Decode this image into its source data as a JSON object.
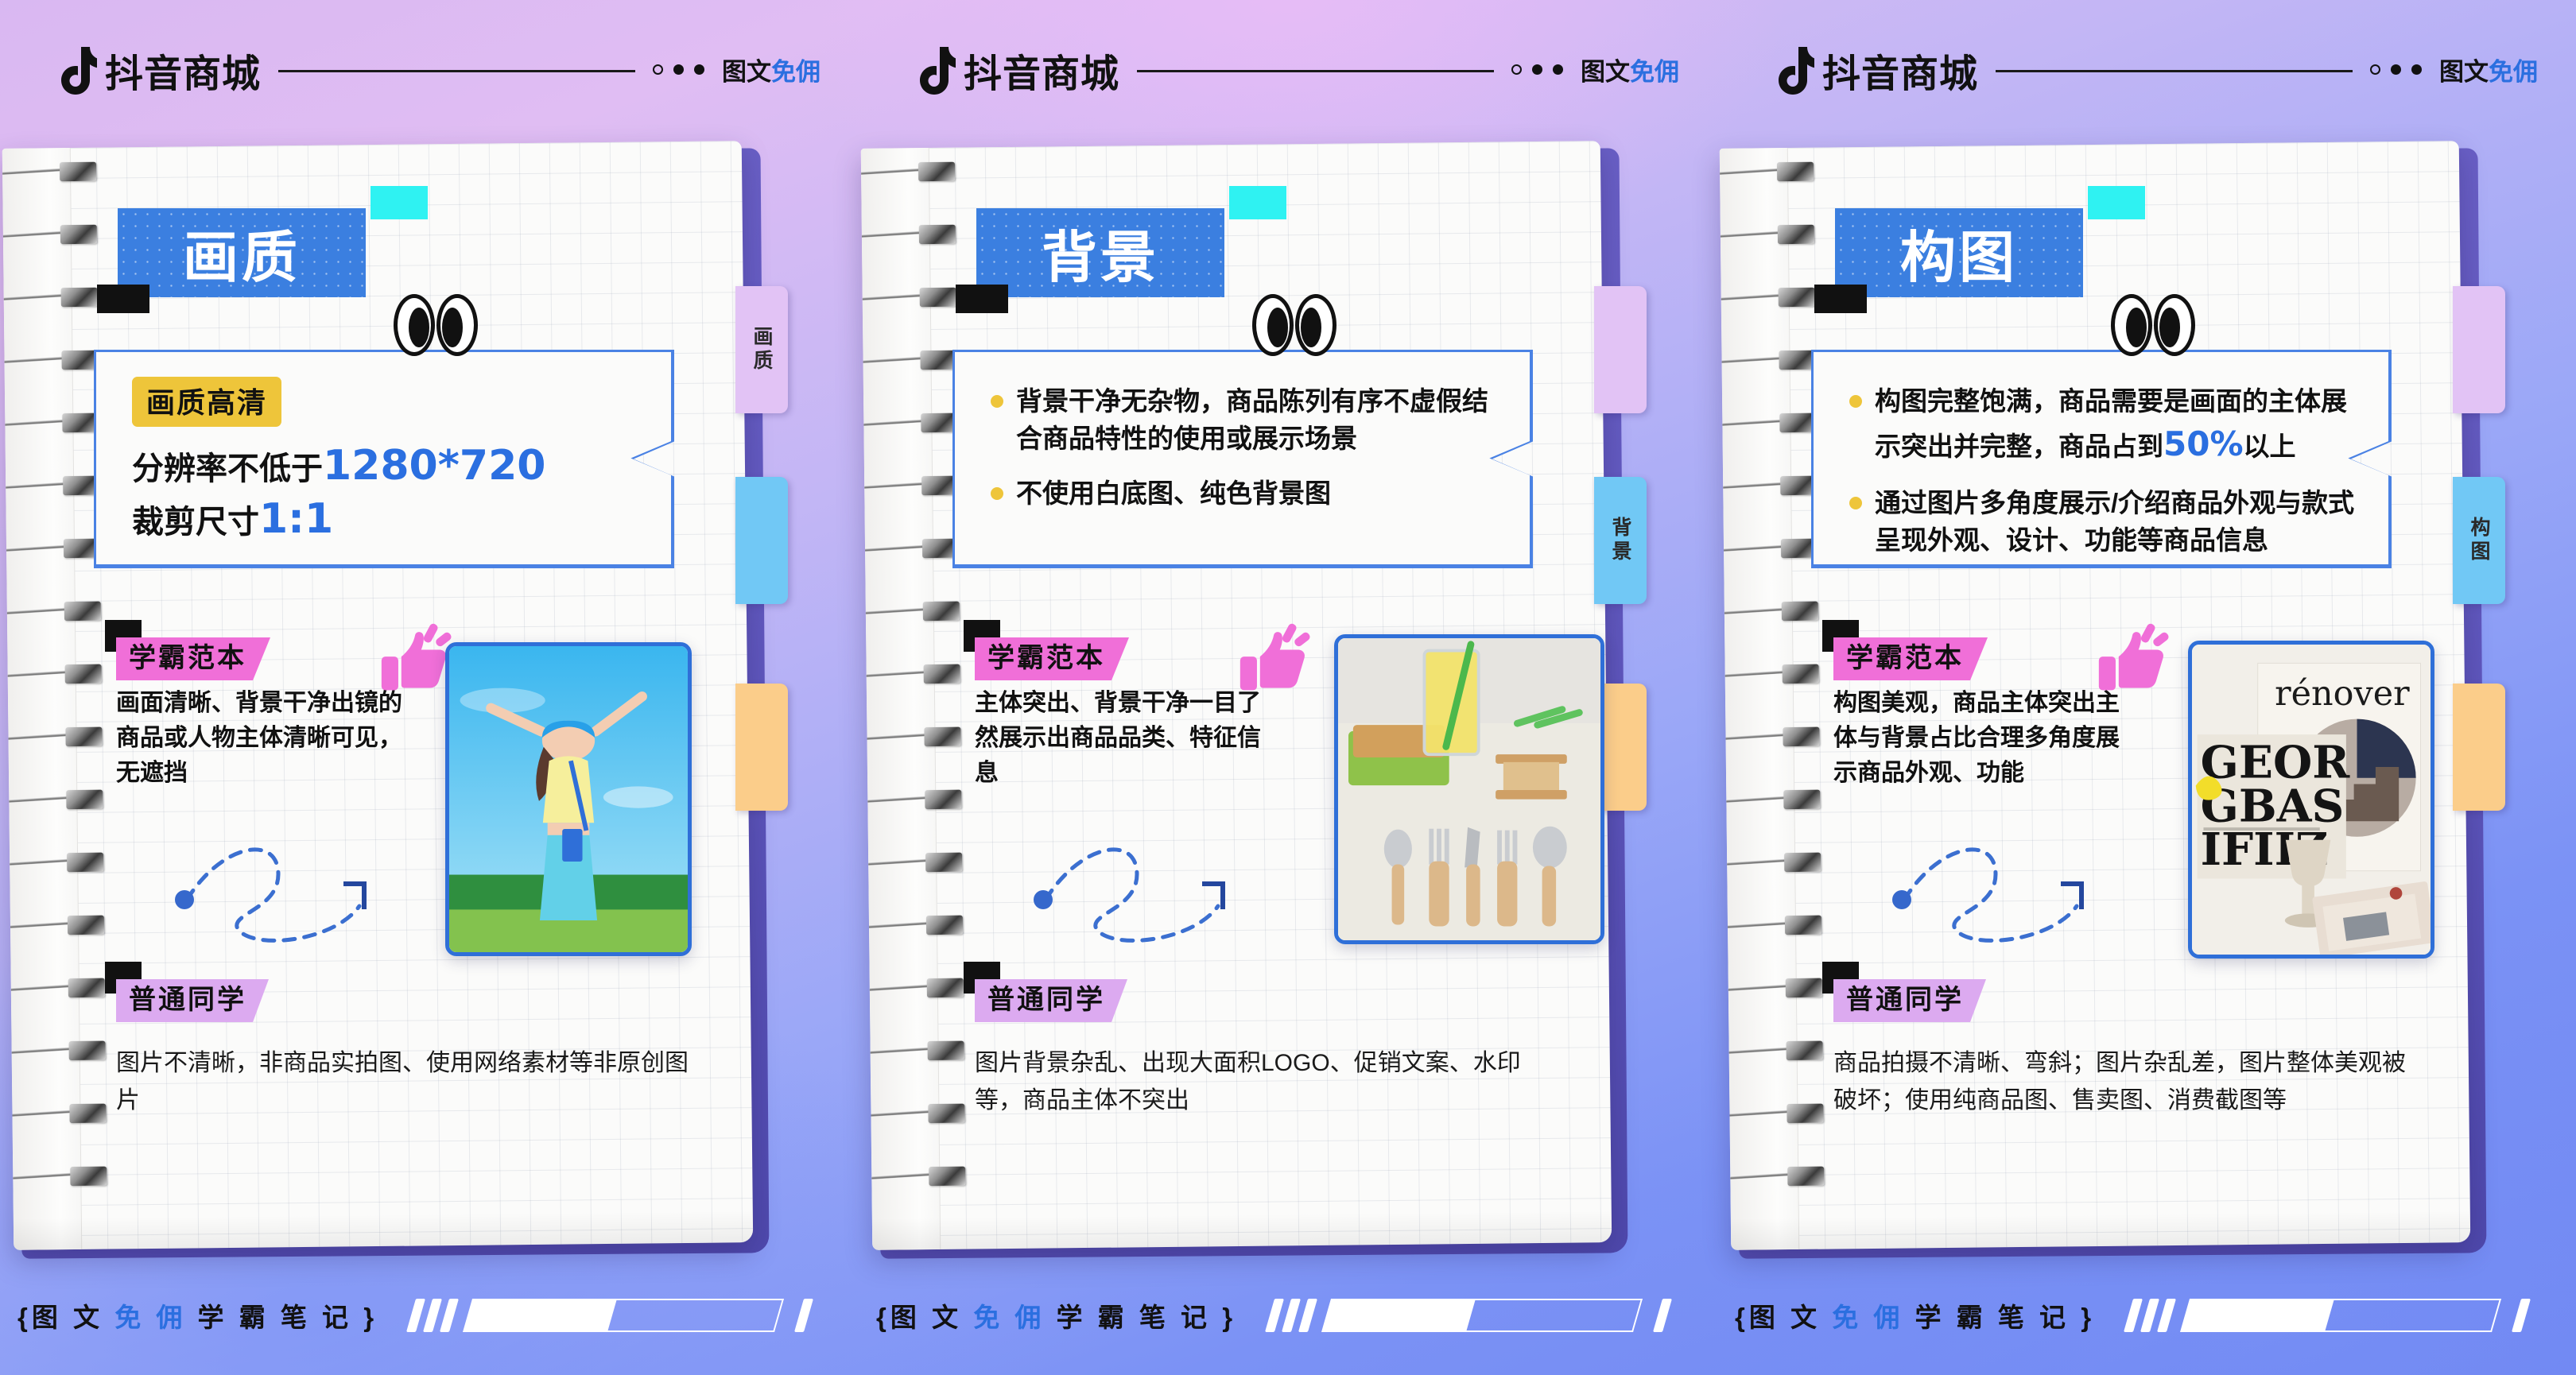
{
  "brand": {
    "name": "抖音商城",
    "logo_icon": "tiktok-note-icon",
    "tagline_plain": "图文",
    "tagline_highlight": "免佣",
    "accent_blue": "#2b6fe0",
    "title_chip_blue": "#3b7fe0",
    "cyan_chip": "#2ff2f2",
    "yellow_badge": "#eec53a",
    "pink_chip": "#f06fd8",
    "violet_chip": "#dcaaf0"
  },
  "footer": {
    "open_brace": "{",
    "text_a": "图 文 ",
    "text_hl": "免 佣",
    "text_b": "  学 霸 笔 记 ",
    "close_brace": "}"
  },
  "side_tabs": {
    "labels": [
      "画质",
      "背景",
      "构图"
    ],
    "colors": [
      "#e2c3f5",
      "#71c8f5",
      "#fbcd8a"
    ]
  },
  "panels": [
    {
      "title": "画质",
      "active_tab_index": 0,
      "callout": {
        "style": "badge",
        "badge": "画质高清",
        "lines": [
          {
            "pre": "分辨率不低于",
            "num": "1280*720"
          },
          {
            "pre": "裁剪尺寸",
            "num": "1:1"
          }
        ]
      },
      "good": {
        "label": "学霸范本",
        "text": "画面清晰、背景干净出镜的商品或人物主体清晰可见，无遮挡",
        "thumb_icon": "thumbs-up-icon",
        "photo_alt": "户外张开双臂的运动女孩照片"
      },
      "bad": {
        "label": "普通同学",
        "text": "图片不清晰，非商品实拍图、使用网络素材等非原创图片"
      }
    },
    {
      "title": "背景",
      "active_tab_index": 1,
      "callout": {
        "style": "bullets",
        "bullets": [
          {
            "text": "背景干净无杂物，商品陈列有序不虚假结合商品特性的使用或展示场景"
          },
          {
            "text": "不使用白底图、纯色背景图"
          }
        ]
      },
      "good": {
        "label": "学霸范本",
        "text": "主体突出、背景干净一目了然展示出商品品类、特征信息",
        "thumb_icon": "thumbs-up-icon",
        "photo_alt": "桌上饮品与竹制餐具照片"
      },
      "bad": {
        "label": "普通同学",
        "text": "图片背景杂乱、出现大面积LOGO、促销文案、水印等，商品主体不突出"
      }
    },
    {
      "title": "构图",
      "active_tab_index": 2,
      "callout": {
        "style": "bullets",
        "bullets": [
          {
            "pre": "构图完整饱满，商品需要是画面的主体展示突出并完整，商品占到",
            "hl": "50%",
            "post": "以上"
          },
          {
            "text": "通过图片多角度展示/介绍商品外观与款式呈现外观、设计、功能等商品信息"
          }
        ]
      },
      "good": {
        "label": "学霸范本",
        "text": "构图美观，商品主体突出主体与背景占比合理多角度展示商品外观、功能",
        "thumb_icon": "thumbs-up-icon",
        "photo_alt": "杂志 rénover 与石杯摆拍照片"
      },
      "bad": {
        "label": "普通同学",
        "text": "商品拍摄不清晰、弯斜；图片杂乱差，图片整体美观被破坏；使用纯商品图、售卖图、消费截图等"
      }
    }
  ]
}
